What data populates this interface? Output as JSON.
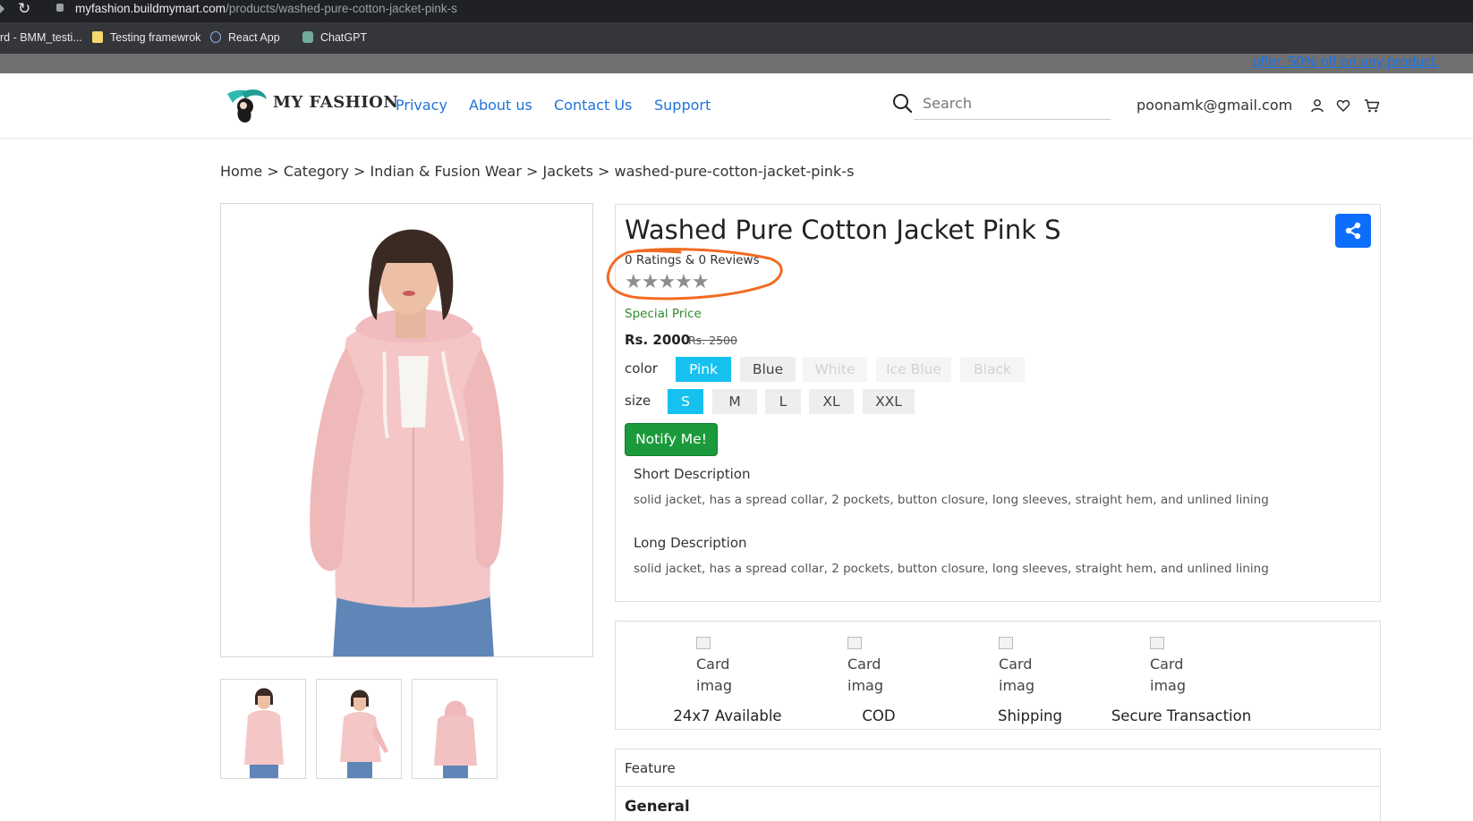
{
  "browser": {
    "url_host": "myfashion.buildmymart.com",
    "url_path": "/products/washed-pure-cotton-jacket-pink-s",
    "bookmarks": [
      "rd - BMM_testi...",
      "Testing framewrok",
      "React App",
      "ChatGPT"
    ]
  },
  "offer": {
    "text": "offer. 50% off on any product."
  },
  "header": {
    "logo_text": "MY FASHION",
    "nav": [
      "Privacy",
      "About us",
      "Contact Us",
      "Support"
    ],
    "search_placeholder": "Search",
    "user_email": "poonamk@gmail.com"
  },
  "breadcrumb": "Home > Category > Indian & Fusion Wear > Jackets > washed-pure-cotton-jacket-pink-s",
  "product": {
    "title": "Washed Pure Cotton Jacket Pink S",
    "ratings_text": "0 Ratings & 0 Reviews",
    "stars": "★★★★★",
    "special_price_label": "Special Price",
    "price": "Rs. 2000",
    "mrp": "Rs. 2500",
    "color_label": "color",
    "colors": [
      "Pink",
      "Blue",
      "White",
      "Ice Blue",
      "Black"
    ],
    "size_label": "size",
    "sizes": [
      "S",
      "M",
      "L",
      "XL",
      "XXL"
    ],
    "notify_label": "Notify Me!",
    "short_desc_title": "Short Description",
    "short_desc": "solid jacket, has a spread collar, 2 pockets, button closure, long sleeves, straight hem, and unlined lining",
    "long_desc_title": "Long Description",
    "long_desc": "solid jacket, has a spread collar, 2 pockets, button closure, long sleeves, straight hem, and unlined lining"
  },
  "services": {
    "img_alt_line1": "Card",
    "img_alt_line2": "imag",
    "items": [
      "24x7 Available",
      "COD",
      "Shipping",
      "Secure Transaction"
    ]
  },
  "feature": {
    "title": "Feature",
    "section": "General"
  },
  "colors": {
    "accent_blue": "#0d6efd",
    "selected_chip": "#17c1ef",
    "notify_green": "#1a9a3b",
    "annotation_orange": "#f26a21"
  }
}
